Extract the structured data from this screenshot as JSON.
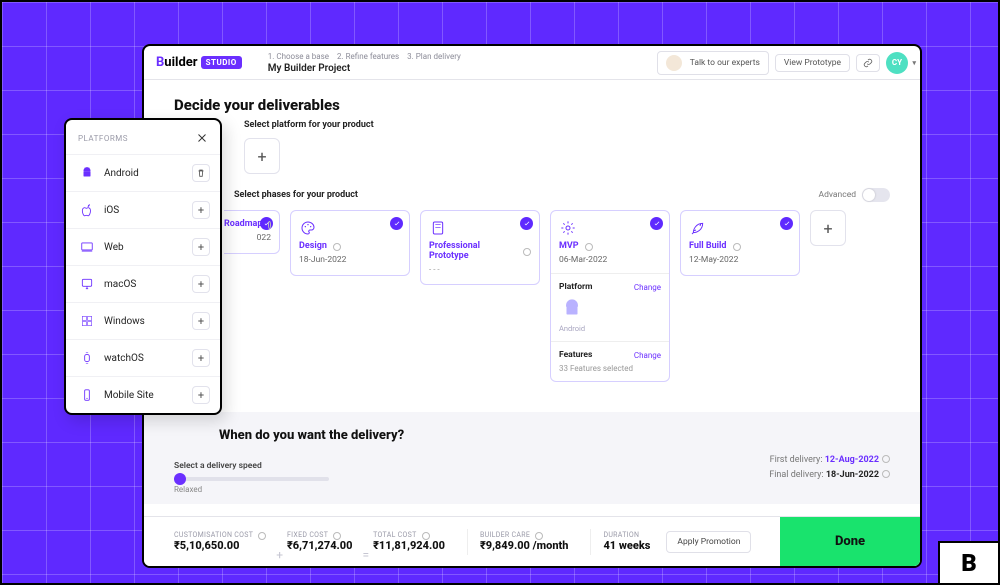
{
  "header": {
    "logo_text_1": "B",
    "logo_text_2": "uilder",
    "logo_badge": "STUDIO",
    "steps": [
      "1. Choose a base",
      "2. Refine features",
      "3. Plan delivery"
    ],
    "project_name": "My Builder Project",
    "talk_experts": "Talk to our experts",
    "view_prototype": "View Prototype",
    "avatar_initials": "CY"
  },
  "deliverables": {
    "title": "Decide your deliverables",
    "platform_sub": "Select platform for your product",
    "phases_sub": "Select phases for your product",
    "advanced_label": "Advanced"
  },
  "phases": {
    "roadmap": {
      "title": "Roadmap",
      "date": "022"
    },
    "design": {
      "title": "Design",
      "date": "18-Jun-2022"
    },
    "proto": {
      "title": "Professional Prototype",
      "date": "---"
    },
    "mvp": {
      "title": "MVP",
      "date": "06-Mar-2022",
      "platform_label": "Platform",
      "platform_change": "Change",
      "platform_name": "Android",
      "features_label": "Features",
      "features_change": "Change",
      "features_text": "33 Features selected"
    },
    "full": {
      "title": "Full Build",
      "date": "12-May-2022"
    }
  },
  "delivery": {
    "question": "When do you want the delivery?",
    "speed_label": "Select a delivery speed",
    "speed_value": "Relaxed",
    "first_label": "First delivery:",
    "first_value": "12-Aug-2022",
    "final_label": "Final delivery:",
    "final_value": "18-Jun-2022"
  },
  "footer": {
    "custom_label": "CUSTOMISATION COST",
    "custom_value": "₹5,10,650.00",
    "fixed_label": "FIXED COST",
    "fixed_value": "₹6,71,274.00",
    "total_label": "TOTAL COST",
    "total_value": "₹11,81,924.00",
    "care_label": "BUILDER CARE",
    "care_value": "₹9,849.00 /month",
    "duration_label": "DURATION",
    "duration_value": "41 weeks",
    "promo": "Apply Promotion",
    "done": "Done"
  },
  "platforms": {
    "title": "PLATFORMS",
    "items": [
      {
        "name": "Android",
        "selected": true
      },
      {
        "name": "iOS",
        "selected": false
      },
      {
        "name": "Web",
        "selected": false
      },
      {
        "name": "macOS",
        "selected": false
      },
      {
        "name": "Windows",
        "selected": false
      },
      {
        "name": "watchOS",
        "selected": false
      },
      {
        "name": "Mobile Site",
        "selected": false
      }
    ]
  },
  "brand_badge": "B"
}
